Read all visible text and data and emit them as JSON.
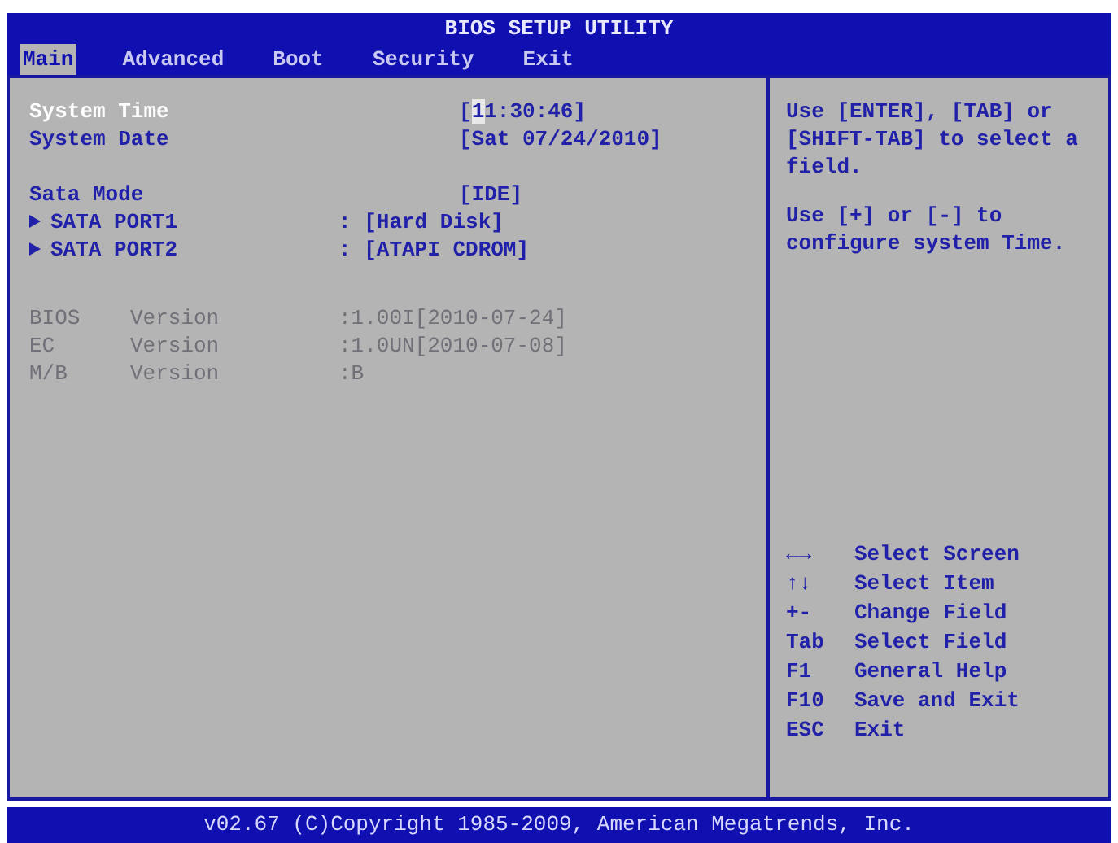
{
  "window": {
    "title": "BIOS SETUP UTILITY"
  },
  "tabs": [
    {
      "label": "Main",
      "selected": true
    },
    {
      "label": "Advanced",
      "selected": false
    },
    {
      "label": "Boot",
      "selected": false
    },
    {
      "label": "Security",
      "selected": false
    },
    {
      "label": "Exit",
      "selected": false
    }
  ],
  "settings": [
    {
      "kind": "field",
      "label": "System Time",
      "selected": true,
      "value_start": "[",
      "cursor": "1",
      "value": "1:30:46]"
    },
    {
      "kind": "field",
      "label": "System Date",
      "selected": false,
      "value": "[Sat 07/24/2010]"
    },
    {
      "kind": "gap"
    },
    {
      "kind": "field",
      "label": "Sata Mode",
      "selected": false,
      "value": "[IDE]"
    },
    {
      "kind": "submenu",
      "label": "SATA PORT1",
      "selected": false,
      "value": ": [Hard Disk]"
    },
    {
      "kind": "submenu",
      "label": "SATA PORT2",
      "selected": false,
      "value": ": [ATAPI CDROM]"
    }
  ],
  "versions": [
    {
      "name": "BIOS",
      "label": "Version",
      "value": ":1.00I[2010-07-24]",
      "disabled": true
    },
    {
      "name": "EC",
      "label": "Version",
      "value": ":1.0UN[2010-07-08]",
      "disabled": true
    },
    {
      "name": "M/B",
      "label": "Version",
      "value": ":B",
      "disabled": true
    }
  ],
  "help": [
    "Use [ENTER], [TAB] or [SHIFT-TAB] to select a field.",
    "Use [+] or [-] to configure system Time."
  ],
  "legend": [
    {
      "key": "←→",
      "action": "Select Screen"
    },
    {
      "key": "↑↓",
      "action": "Select Item"
    },
    {
      "key": "+-",
      "action": "Change Field"
    },
    {
      "key": "Tab",
      "action": "Select Field"
    },
    {
      "key": "F1",
      "action": "General Help"
    },
    {
      "key": "F10",
      "action": "Save and Exit"
    },
    {
      "key": "ESC",
      "action": "Exit"
    }
  ],
  "status_bar": "v02.67 (C)Copyright 1985-2009, American Megatrends, Inc."
}
